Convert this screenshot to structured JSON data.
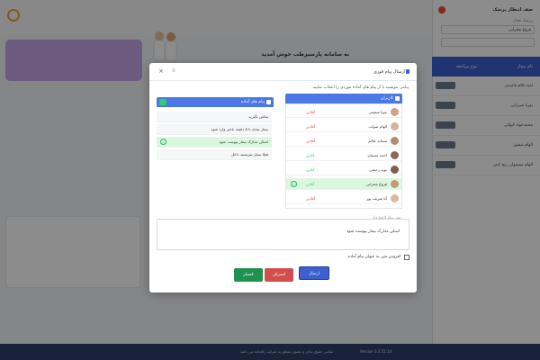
{
  "app": {
    "sidebar_title": "صف انتظار پزشک",
    "sidebar_label": "پزشک فعال",
    "doctor_select": "فروغ محرابی",
    "table_header_name": "نام بیمار",
    "table_header_type": "نوع مراجعه",
    "patients": [
      "امید غلام قاسمی",
      "پوریا میرزایی",
      "محمدجواد کیهانی",
      "الهام شفیق",
      "الهام مشمولی رنج کش"
    ],
    "welcome": "به سامانه پارسیزطب خوش آمدید",
    "footer_copy": "تمامی حقوق مادی و معنوی متعلق به شرکت رافخانه می باشد",
    "footer_version": "Version 3.3.51.14"
  },
  "modal": {
    "title": "ارسال پیام فوری",
    "instructions": "پیامی بنویسید یا از پیام های آماده موردی را انتخاب نمایید.",
    "users_header": "کاربران",
    "messages_header": "پیام های آماده",
    "users": [
      {
        "name": "مونا شفیعی",
        "status": "آفلاین",
        "selected": false
      },
      {
        "name": "الهام صولت",
        "status": "آفلاین",
        "selected": false
      },
      {
        "name": "سمانه علائم",
        "status": "آفلاین",
        "selected": false
      },
      {
        "name": "احمد محبیان",
        "status": "آنلاین",
        "selected": false
      },
      {
        "name": "نوید رحیمی",
        "status": "آنلاین",
        "selected": false
      },
      {
        "name": "فروغ محرابی",
        "status": "آنلاین",
        "selected": true
      },
      {
        "name": "آنا شریف پور",
        "status": "آفلاین",
        "selected": false
      }
    ],
    "messages": [
      {
        "text": "تماس بگیرید",
        "selected": false
      },
      {
        "text": "بیمار بعدی با ۵ دقیقه تاخیر وارد شود",
        "selected": false
      },
      {
        "text": "اسکن مدارک بیمار پیوست شود",
        "selected": true
      },
      {
        "text": "فعلا بیمار نفرستید داخل",
        "selected": false
      }
    ],
    "textarea_label": "متن پیام (اجباری)",
    "textarea_value": "اسکن مدارک بیمار پیوست شود",
    "checkbox_label": "افزودن متن به عنوان پیام آماده",
    "send_label": "ارسال",
    "cancel_label": "انصراف",
    "new_label": "کنسلر"
  },
  "colors": {
    "primary": "#3d5fcf",
    "online": "#2ecc71",
    "offline": "#e74c3c",
    "success": "#1f9150",
    "danger": "#d44d4d"
  }
}
